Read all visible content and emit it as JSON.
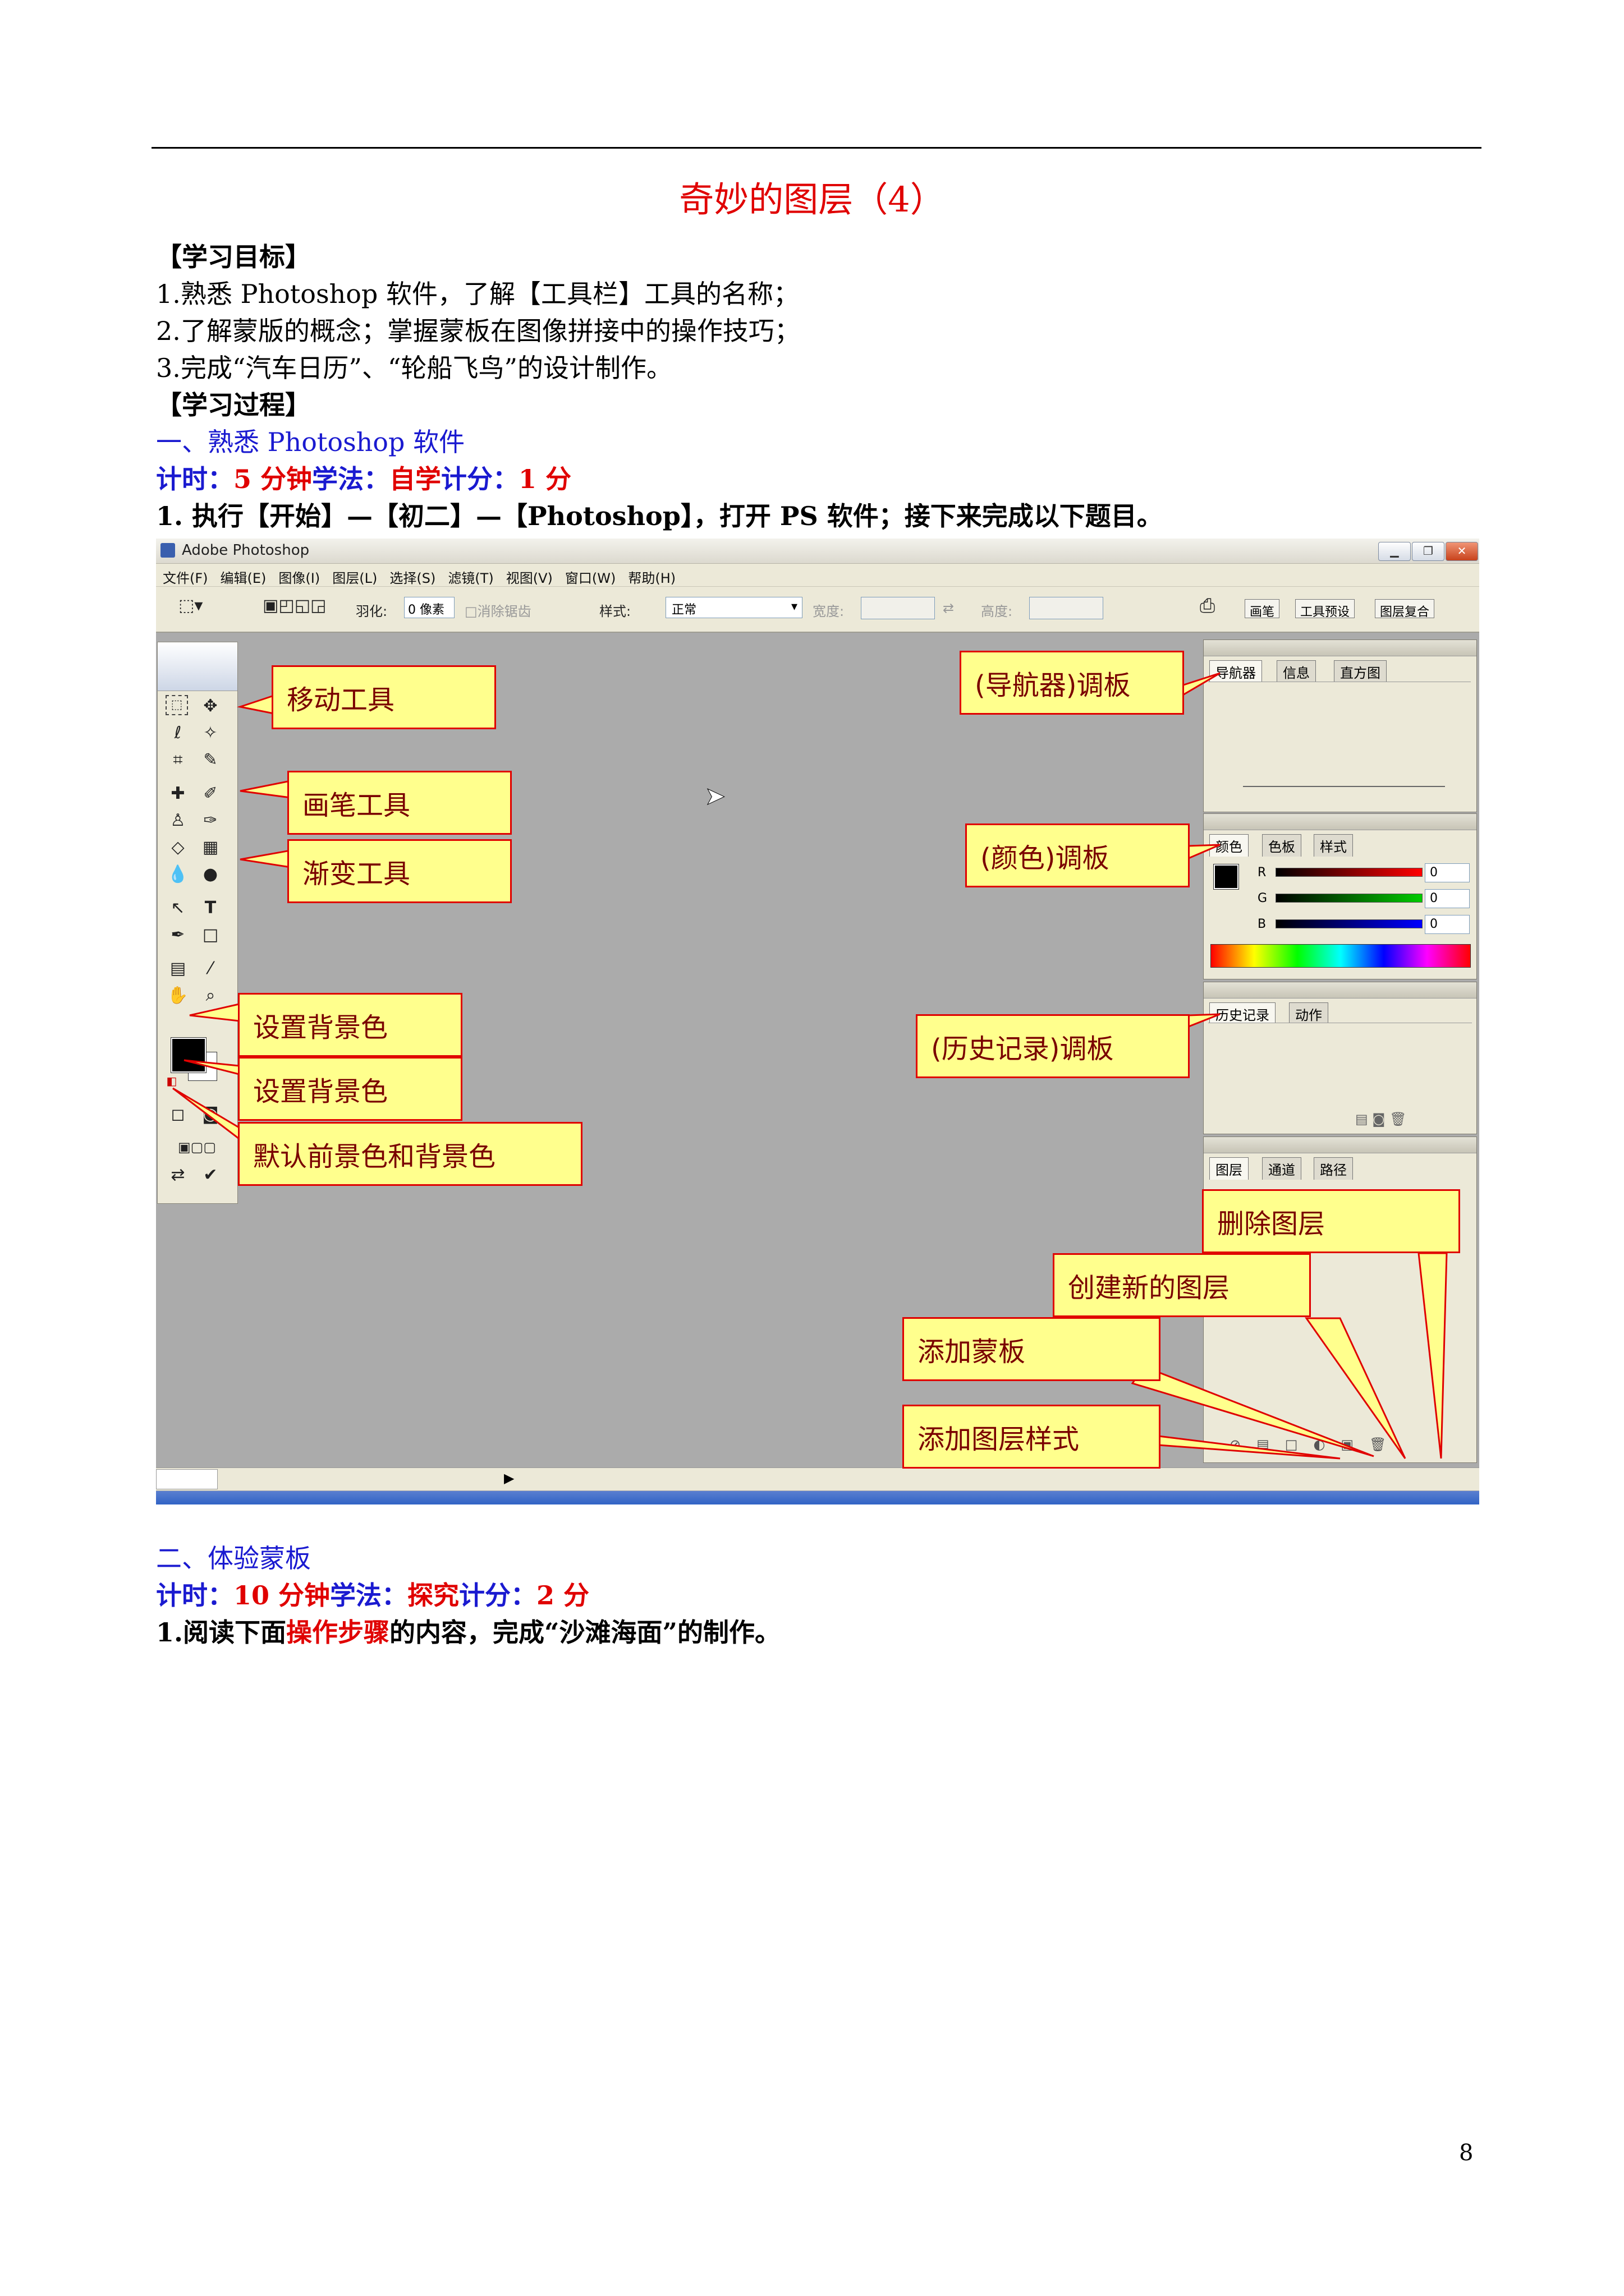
{
  "title": "奇妙的图层（4）",
  "objectives": {
    "heading": "【学习目标】",
    "items": [
      "1.熟悉 Photoshop 软件，了解【工具栏】工具的名称；",
      "2.了解蒙版的概念；掌握蒙板在图像拼接中的操作技巧；",
      "3.完成“汽车日历”、“轮船飞鸟”的设计制作。"
    ]
  },
  "process_heading": "【学习过程】",
  "section1": {
    "heading": "一、熟悉 Photoshop 软件",
    "time_label": "计时：",
    "time_value": "5 分钟",
    "method_label": "学法：",
    "method_value": "自学",
    "score_label": "计分：",
    "score_value": "1 分",
    "step": "1. 执行【开始】—【初二】—【Photoshop】，打开 PS 软件；接下来完成以下题目。"
  },
  "screenshot": {
    "window_title": "Adobe Photoshop",
    "menu": [
      "文件(F)",
      "编辑(E)",
      "图像(I)",
      "图层(L)",
      "选择(S)",
      "滤镜(T)",
      "视图(V)",
      "窗口(W)",
      "帮助(H)"
    ],
    "options": {
      "feather_label": "羽化:",
      "feather_value": "0 像素",
      "antialias": "□消除锯齿",
      "style_label": "样式:",
      "style_value": "正常",
      "width_label": "宽度:",
      "height_label": "高度:",
      "tabs": [
        "画笔",
        "工具预设",
        "图层复合"
      ]
    },
    "navigator_tabs": [
      "导航器",
      "信息",
      "直方图"
    ],
    "color_tabs": [
      "颜色",
      "色板",
      "样式"
    ],
    "rgb_labels": [
      "R",
      "G",
      "B"
    ],
    "rgb_values": [
      "0",
      "0",
      "0"
    ],
    "history_tabs": [
      "历史记录",
      "动作"
    ],
    "layers_tabs": [
      "图层",
      "通道",
      "路径"
    ],
    "callouts": {
      "move": "移动工具",
      "brush": "画笔工具",
      "gradient": "渐变工具",
      "bg1": "设置背景色",
      "bg2": "设置背景色",
      "default_colors": "默认前景色和背景色",
      "navigator": "(导航器)调板",
      "color": "(颜色)调板",
      "history": "(历史记录)调板",
      "delete_layer": "删除图层",
      "new_layer": "创建新的图层",
      "add_mask": "添加蒙板",
      "add_style": "添加图层样式"
    }
  },
  "section2": {
    "heading": "二、体验蒙板",
    "time_label": "计时：",
    "time_value": "10 分钟",
    "method_label": "学法：",
    "method_value": "探究",
    "score_label": "计分：",
    "score_value": "2 分",
    "step_prefix": "1.阅读下面",
    "step_highlight": "操作步骤",
    "step_suffix": "的内容，完成“沙滩海面”的制作。"
  },
  "page_number": "8",
  "colors": {
    "title": "#e00000",
    "section": "#1a1ad0",
    "callout_fill": "#ffff8d",
    "callout_border": "#e00000"
  }
}
